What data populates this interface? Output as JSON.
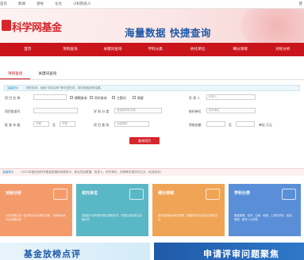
{
  "topbar": {
    "links": [
      "首页",
      "新闻",
      "领导",
      "论文",
      "小科院名人"
    ],
    "right": "登"
  },
  "brand": {
    "logo_text": "科学网基金",
    "slogan": "海量数据  快捷查询",
    "colors": {
      "primary_red": "#c9141b",
      "brand_blue": "#1f5aa8"
    }
  },
  "nav": {
    "items": [
      "首页",
      "项目查询",
      "关键词查询",
      "学科分类",
      "依托单位",
      "细分领域",
      "对标分析"
    ]
  },
  "tabs": [
    "项目查询",
    "关键词查询"
  ],
  "notice": {
    "tag": "温馨提示",
    "text": "：同时查询，使用“项目名称”等可选的词，同时搜索到的结果。"
  },
  "form": {
    "project_name_label": "项 目 名 称",
    "fuzzy_label": "模糊查询",
    "exact_label": "同时查询",
    "theme_label": "主题词",
    "abstract_label": "摘要",
    "pi_label": "负 责 人",
    "pi_placeholder": "负责人",
    "approval_label": "项目批准号",
    "discipline_label": "学 科 分 类",
    "discipline_value": "请选择学科分类",
    "unit_label": "依托单位",
    "unit_placeholder": "依托单位",
    "year_label": "批 准 年 度",
    "year_from": "不限",
    "to_label": "至",
    "year_to": "不限",
    "category_label": "项 目 类 别",
    "category_value": "全部类别",
    "amount_label": "资助金额",
    "amount_to": "至",
    "amount_unit": "单位:万元",
    "submit": "查询项目"
  },
  "info_strip": {
    "tag": "温馨提示",
    "text": "：2022年度自然科学基金数据持续更新中，新近项目数据、信息人、依托单位、资助情况请访问主页，欢迎查询！"
  },
  "cards": [
    {
      "title": "对标分析",
      "desc": "以依托单位及一级学科为对标研究对象，分析科研水平及发展态势",
      "icon": "compare-icon"
    },
    {
      "title": "依托单位",
      "desc": "全国四十余所依托单位获批情况，同类比例及排名全面分析",
      "icon": "building-icon"
    },
    {
      "title": "细分领域",
      "desc": "按关键词细分研究领域，把握学科热点及前沿研究方向",
      "icon": "grid-icon"
    },
    {
      "title": "学科分类",
      "desc": "覆盖数理、化学、生命、地球、工程与材料、信息、管理、医学八大学部",
      "icon": "chart-icon"
    }
  ],
  "bottom": [
    {
      "title": "基金放榜点评"
    },
    {
      "title": "申请评审问题聚焦"
    }
  ]
}
